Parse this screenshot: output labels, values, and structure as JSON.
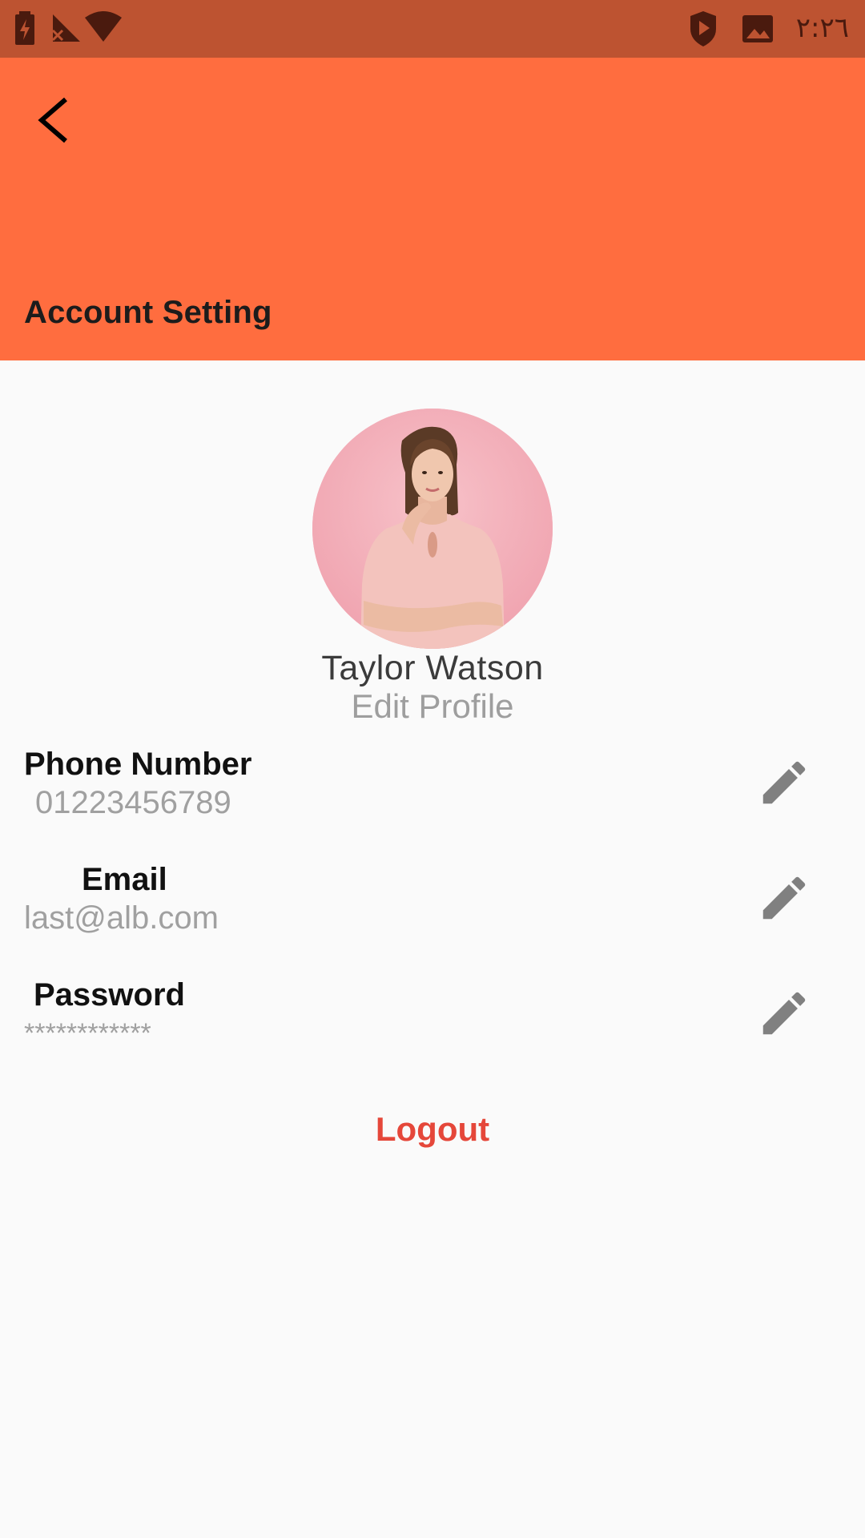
{
  "status_bar": {
    "time": "٢:٢٦",
    "left_icons": [
      "battery-charging-icon",
      "no-signal-icon",
      "wifi-icon"
    ],
    "right_icons": [
      "shield-play-icon",
      "image-icon"
    ]
  },
  "app_bar": {
    "title": "Account Setting",
    "back_icon": "chevron-left-icon",
    "color": "#ff6d3f"
  },
  "profile": {
    "name": "Taylor Watson",
    "edit_label": "Edit Profile"
  },
  "fields": [
    {
      "label": "Phone Number",
      "value": "01223456789"
    },
    {
      "label": "Email",
      "value": "last@alb.com"
    },
    {
      "label": "Password",
      "value": "************"
    }
  ],
  "logout_label": "Logout",
  "colors": {
    "status_bar": "#bd5331",
    "accent": "#ff6d3f",
    "logout": "#e5473a",
    "edit_icon": "#808080"
  }
}
